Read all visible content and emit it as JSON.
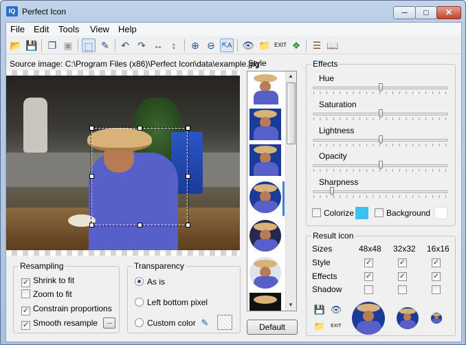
{
  "window": {
    "title": "Perfect Icon",
    "app_icon_text": "IQ"
  },
  "menu": [
    "File",
    "Edit",
    "Tools",
    "View",
    "Help"
  ],
  "toolbar_icons": [
    "open-icon",
    "save-icon",
    "copy-icon",
    "paste-icon",
    "select-icon",
    "picker-icon",
    "rotate-left-icon",
    "rotate-right-icon",
    "flip-horizontal-icon",
    "flip-vertical-icon",
    "zoom-in-icon",
    "zoom-out-icon",
    "auto-fit-icon",
    "preview-icon",
    "export-icon",
    "exit-icon",
    "windows-icon",
    "script-icon",
    "help-book-icon"
  ],
  "source": {
    "label": "Source image: C:\\Program Files (x86)\\Perfect Icon\\data\\example.jpg"
  },
  "resampling": {
    "title": "Resampling",
    "options": [
      {
        "label": "Shrink to fit",
        "checked": true
      },
      {
        "label": "Zoom to fit",
        "checked": false
      },
      {
        "label": "Constrain proportions",
        "checked": true
      },
      {
        "label": "Smooth resample",
        "checked": true
      }
    ],
    "more_label": "..."
  },
  "transparency": {
    "title": "Transparency",
    "options": [
      {
        "label": "As is",
        "selected": true
      },
      {
        "label": "Left bottom pixel",
        "selected": false
      },
      {
        "label": "Custom color",
        "selected": false
      }
    ]
  },
  "style": {
    "title": "Style",
    "default_label": "Default"
  },
  "effects": {
    "title": "Effects",
    "sliders": [
      {
        "label": "Hue",
        "value": 0.5
      },
      {
        "label": "Saturation",
        "value": 0.5
      },
      {
        "label": "Lightness",
        "value": 0.5
      },
      {
        "label": "Opacity",
        "value": 0.5
      },
      {
        "label": "Sharpness",
        "value": 0.125
      }
    ],
    "colorize_label": "Colorize",
    "colorize_checked": false,
    "colorize_color": "#3cc2ee",
    "background_label": "Background",
    "background_checked": false,
    "background_color": "#ffffff"
  },
  "result": {
    "title": "Result icon",
    "sizes_label": "Sizes",
    "sizes": [
      "48x48",
      "32x32",
      "16x16"
    ],
    "rows": [
      {
        "label": "Style",
        "checks": [
          true,
          true,
          true
        ]
      },
      {
        "label": "Effects",
        "checks": [
          true,
          true,
          true
        ]
      },
      {
        "label": "Shadow",
        "checks": [
          false,
          false,
          false
        ]
      }
    ]
  }
}
